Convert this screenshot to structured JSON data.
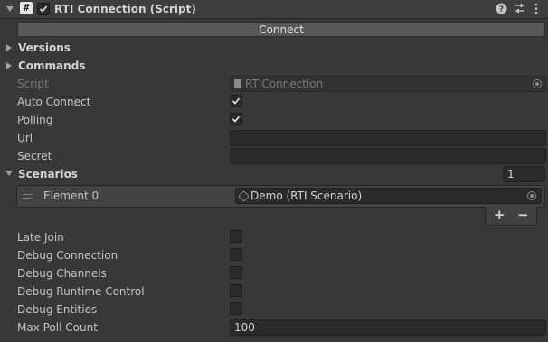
{
  "header": {
    "title": "RTI Connection (Script)",
    "script_icon_glyph": "#",
    "enabled": true
  },
  "connect_button": "Connect",
  "sections": {
    "versions": "Versions",
    "commands": "Commands",
    "scenarios": "Scenarios"
  },
  "fields": {
    "script": {
      "label": "Script",
      "value": "RTIConnection"
    },
    "auto_connect": {
      "label": "Auto Connect",
      "checked": true
    },
    "polling": {
      "label": "Polling",
      "checked": true
    },
    "url": {
      "label": "Url",
      "value": ""
    },
    "secret": {
      "label": "Secret",
      "value": ""
    }
  },
  "scenarios": {
    "count": "1",
    "elements": [
      {
        "label": "Element 0",
        "value": "Demo (RTI Scenario)"
      }
    ],
    "add_label": "+",
    "remove_label": "−"
  },
  "options": {
    "late_join": {
      "label": "Late Join",
      "checked": false
    },
    "debug_connection": {
      "label": "Debug Connection",
      "checked": false
    },
    "debug_channels": {
      "label": "Debug Channels",
      "checked": false
    },
    "debug_runtime_control": {
      "label": "Debug Runtime Control",
      "checked": false
    },
    "debug_entities": {
      "label": "Debug Entities",
      "checked": false
    },
    "max_poll_count": {
      "label": "Max Poll Count",
      "value": "100"
    }
  },
  "icons": [
    "fold-down-icon",
    "script-icon",
    "checkbox-icon",
    "help-icon",
    "preset-icon",
    "more-icon",
    "object-picker-icon",
    "drag-handle-icon",
    "scenario-asset-icon"
  ],
  "colors": {
    "background": "#383838",
    "header": "#3e3e3e",
    "field": "#2a2a2a",
    "button": "#585858"
  }
}
